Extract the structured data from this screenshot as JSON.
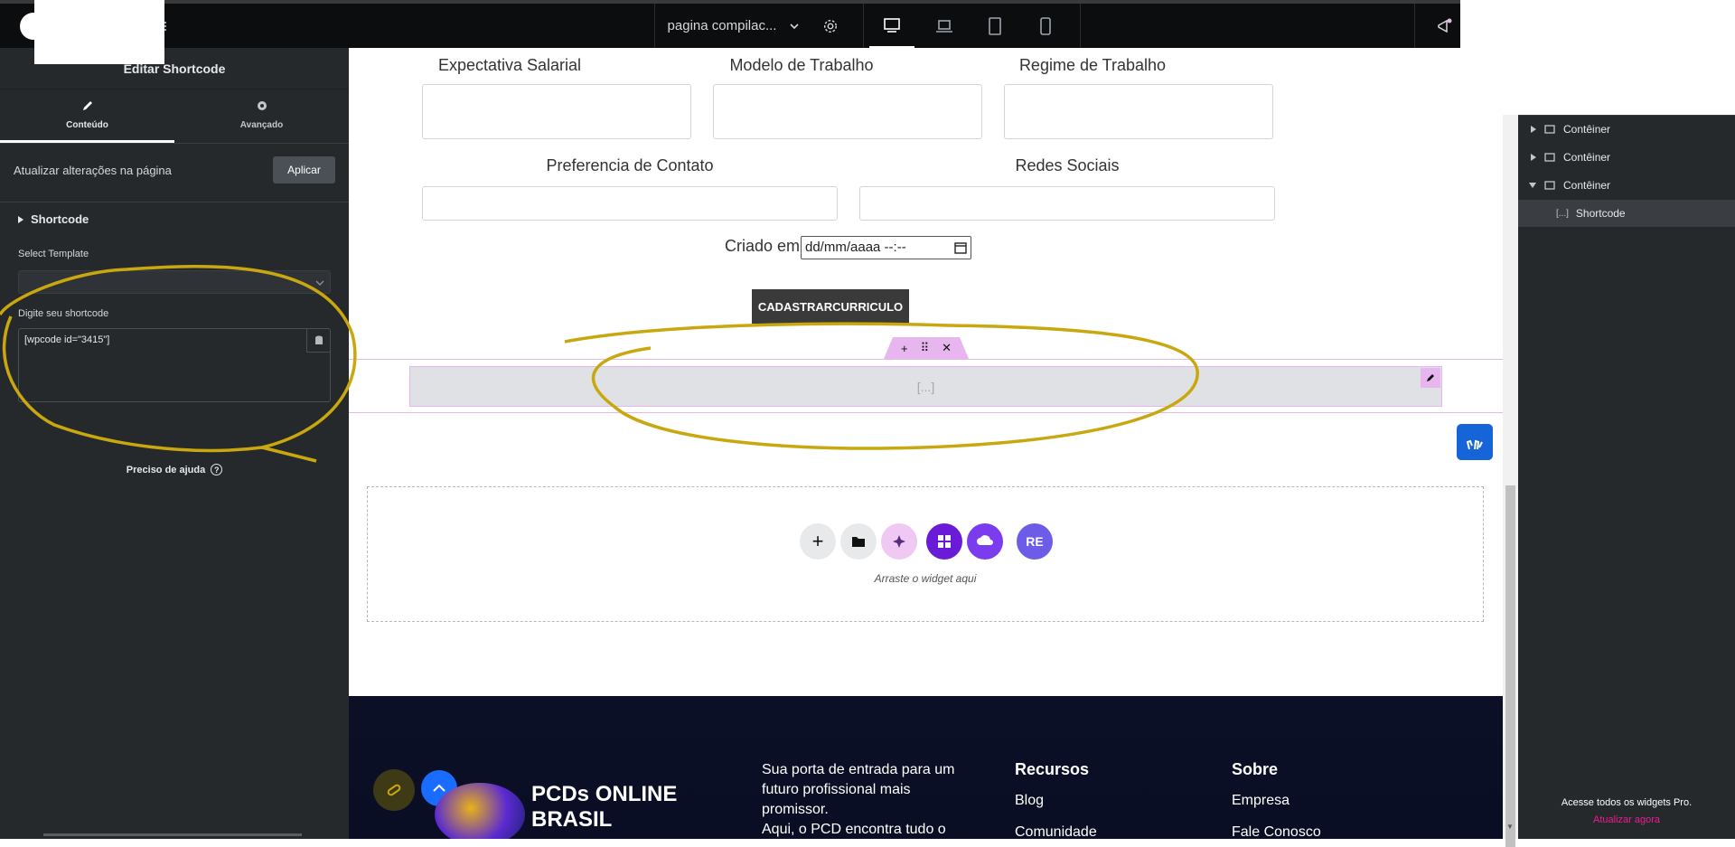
{
  "topbar": {
    "page_name": "pagina compilac...",
    "devices": [
      "desktop-icon",
      "laptop-icon",
      "tablet-icon",
      "mobile-icon"
    ]
  },
  "panel": {
    "title": "Editar Shortcode",
    "tabs": [
      {
        "label": "Conteúdo",
        "icon": "pencil-icon",
        "active": true
      },
      {
        "label": "Avançado",
        "icon": "gear-icon",
        "active": false
      }
    ],
    "update_text": "Atualizar alterações na página",
    "apply_label": "Aplicar",
    "section_title": "Shortcode",
    "select_template_label": "Select Template",
    "shortcode_label": "Digite seu shortcode",
    "shortcode_value": "[wpcode id=\"3415\"]",
    "help_text": "Preciso de ajuda"
  },
  "form": {
    "row1": [
      "Expectativa Salarial",
      "Modelo de Trabalho",
      "Regime de Trabalho"
    ],
    "row2": [
      "Preferencia de Contato",
      "Redes Sociais"
    ],
    "created_label": "Criado em",
    "date_placeholder": "dd/mm/aaaa --:--",
    "submit_label": "CADASTRARCURRICULO"
  },
  "shortcode_widget": {
    "placeholder": "[...]"
  },
  "dropzone": {
    "text": "Arraste o widget aqui"
  },
  "footer": {
    "brand_line1": "PCDs ONLINE",
    "brand_line2": "BRASIL",
    "tagline_lines": [
      "Sua porta de entrada para um",
      "futuro profissional mais",
      "promissor.",
      "Aqui, o PCD encontra tudo o"
    ],
    "col1_title": "Recursos",
    "col1_links": [
      "Blog",
      "Comunidade"
    ],
    "col2_title": "Sobre",
    "col2_links": [
      "Empresa",
      "Fale Conosco"
    ]
  },
  "navigator": {
    "items": [
      {
        "label": "Contêiner",
        "expanded": false
      },
      {
        "label": "Contêiner",
        "expanded": false
      },
      {
        "label": "Contêiner",
        "expanded": true
      }
    ],
    "child_label": "Shortcode",
    "pro_text": "Acesse todos os widgets Pro.",
    "pro_link": "Atualizar agora"
  },
  "colors": {
    "accent_pink": "#e7b6ef",
    "annotation": "#c9a70f",
    "footer_bg": "#0b1026"
  }
}
